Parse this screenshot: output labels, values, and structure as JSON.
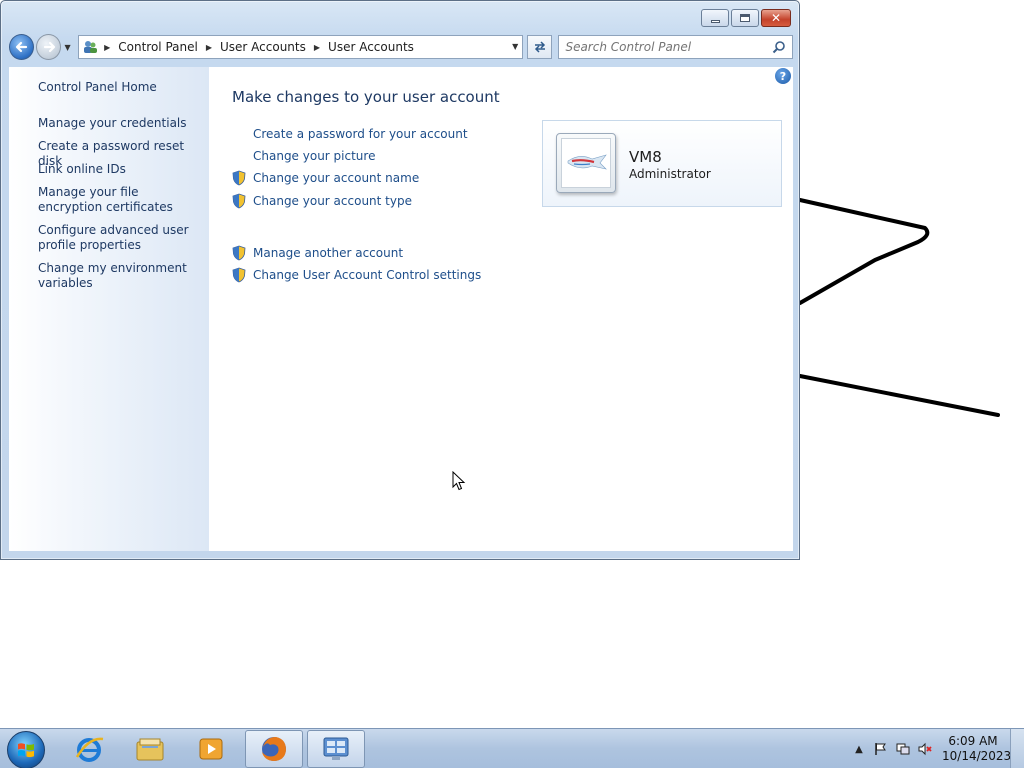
{
  "window": {
    "address": {
      "crumbs": [
        "Control Panel",
        "User Accounts",
        "User Accounts"
      ]
    },
    "search": {
      "placeholder": "Search Control Panel"
    }
  },
  "sidebar": {
    "items": [
      {
        "label": "Control Panel Home"
      },
      {
        "label": "Manage your credentials"
      },
      {
        "label": "Create a password reset disk"
      },
      {
        "label": "Link online IDs"
      },
      {
        "label": "Manage your file encryption certificates"
      },
      {
        "label": "Configure advanced user profile properties"
      },
      {
        "label": "Change my environment variables"
      }
    ]
  },
  "main": {
    "title": "Make changes to your user account",
    "tasks": [
      {
        "label": "Create a password for your account",
        "shield": false
      },
      {
        "label": "Change your picture",
        "shield": false
      },
      {
        "label": "Change your account name",
        "shield": true
      },
      {
        "label": "Change your account type",
        "shield": true
      }
    ],
    "other_tasks": [
      {
        "label": "Manage another account",
        "shield": true
      },
      {
        "label": "Change User Account Control settings",
        "shield": true
      }
    ],
    "user": {
      "name": "VM8",
      "role": "Administrator"
    }
  },
  "taskbar": {
    "pinned": [
      "internet-explorer-icon",
      "windows-explorer-icon",
      "media-player-icon",
      "firefox-icon",
      "control-panel-icon"
    ],
    "clock": {
      "time": "6:09 AM",
      "date": "10/14/2023"
    }
  },
  "colors": {
    "link": "#1e4e8a",
    "heading": "#1e3963",
    "taskbar": "#aec4df"
  }
}
